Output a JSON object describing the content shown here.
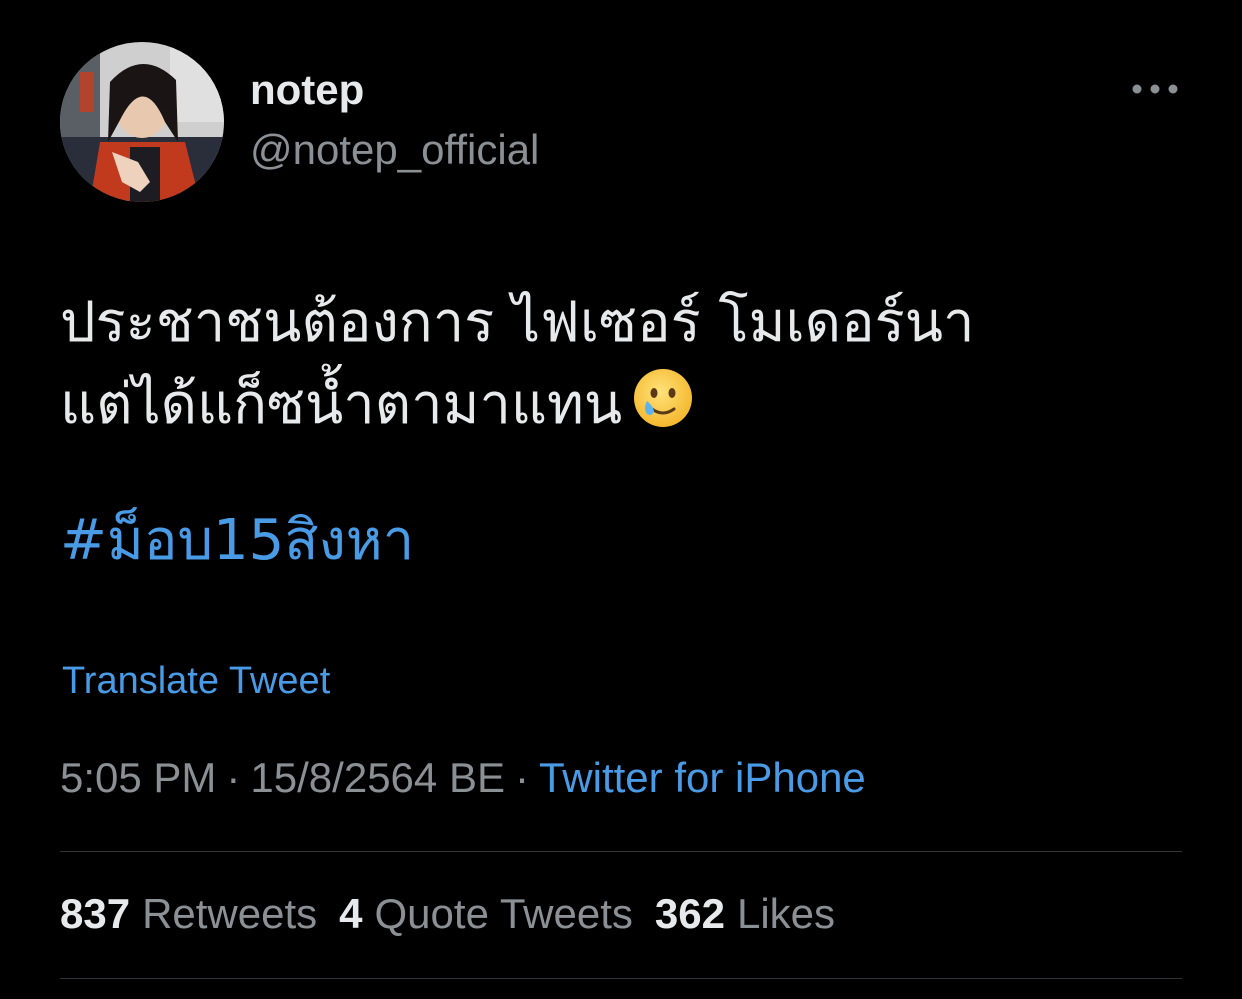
{
  "user": {
    "display_name": "notep",
    "handle": "@notep_official",
    "avatar_icon": "profile-photo"
  },
  "more_icon": "more-horizontal-icon",
  "tweet": {
    "lines": [
      "ประชาชนต้องการ ไฟเซอร์ โมเดอร์นา",
      "แต่ได้แก็ซน้ำตามาแทน"
    ],
    "emoji": "smiling-face-with-tear-emoji",
    "hashtag": "#ม็อบ15สิงหา"
  },
  "translate_label": "Translate Tweet",
  "meta": {
    "time": "5:05 PM",
    "separator": "·",
    "date": "15/8/2564 BE",
    "source": "Twitter for iPhone"
  },
  "stats": {
    "retweets_count": "837",
    "retweets_label": "Retweets",
    "quotes_count": "4",
    "quotes_label": "Quote Tweets",
    "likes_count": "362",
    "likes_label": "Likes"
  },
  "colors": {
    "background": "#000000",
    "primary_text": "#e7e9ea",
    "secondary_text": "#8b9095",
    "link": "#4a9be6",
    "divider": "#2f3336"
  }
}
